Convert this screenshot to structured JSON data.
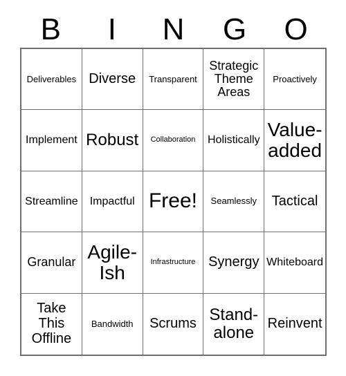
{
  "header": {
    "letters": [
      "B",
      "I",
      "N",
      "G",
      "O"
    ]
  },
  "grid": {
    "rows": 5,
    "columns": 5,
    "border_color": "#6e6e6e",
    "background_color": "#ffffff",
    "text_color": "#000000",
    "cells": [
      {
        "text": "Deliverables",
        "size": "sz-s",
        "name": "bingo-cell-b1"
      },
      {
        "text": "Diverse",
        "size": "sz-l",
        "name": "bingo-cell-i1"
      },
      {
        "text": "Transparent",
        "size": "sz-s",
        "name": "bingo-cell-n1"
      },
      {
        "text": "Strategic\nTheme\nAreas",
        "size": "sz-ml",
        "name": "bingo-cell-g1"
      },
      {
        "text": "Proactively",
        "size": "sz-s",
        "name": "bingo-cell-o1"
      },
      {
        "text": "Implement",
        "size": "sz-m",
        "name": "bingo-cell-b2"
      },
      {
        "text": "Robust",
        "size": "sz-xl",
        "name": "bingo-cell-i2"
      },
      {
        "text": "Collaboration",
        "size": "sz-xs",
        "name": "bingo-cell-n2"
      },
      {
        "text": "Holistically",
        "size": "sz-m",
        "name": "bingo-cell-g2"
      },
      {
        "text": "Value-\nadded",
        "size": "sz-xxl",
        "name": "bingo-cell-o2"
      },
      {
        "text": "Streamline",
        "size": "sz-m",
        "name": "bingo-cell-b3"
      },
      {
        "text": "Impactful",
        "size": "sz-m",
        "name": "bingo-cell-i3"
      },
      {
        "text": "Free!",
        "size": "sz-free",
        "name": "bingo-cell-free-space"
      },
      {
        "text": "Seamlessly",
        "size": "sz-s",
        "name": "bingo-cell-g3"
      },
      {
        "text": "Tactical",
        "size": "sz-l",
        "name": "bingo-cell-o3"
      },
      {
        "text": "Granular",
        "size": "sz-ml",
        "name": "bingo-cell-b4"
      },
      {
        "text": "Agile-\nIsh",
        "size": "sz-xxl",
        "name": "bingo-cell-i4"
      },
      {
        "text": "Infrastructure",
        "size": "sz-xs",
        "name": "bingo-cell-n4"
      },
      {
        "text": "Synergy",
        "size": "sz-l",
        "name": "bingo-cell-g4"
      },
      {
        "text": "Whiteboard",
        "size": "sz-m",
        "name": "bingo-cell-o4"
      },
      {
        "text": "Take\nThis\nOffline",
        "size": "sz-l",
        "name": "bingo-cell-b5"
      },
      {
        "text": "Bandwidth",
        "size": "sz-s",
        "name": "bingo-cell-i5"
      },
      {
        "text": "Scrums",
        "size": "sz-l",
        "name": "bingo-cell-n5"
      },
      {
        "text": "Stand-\nalone",
        "size": "sz-xl",
        "name": "bingo-cell-g5"
      },
      {
        "text": "Reinvent",
        "size": "sz-l",
        "name": "bingo-cell-o5"
      }
    ]
  }
}
